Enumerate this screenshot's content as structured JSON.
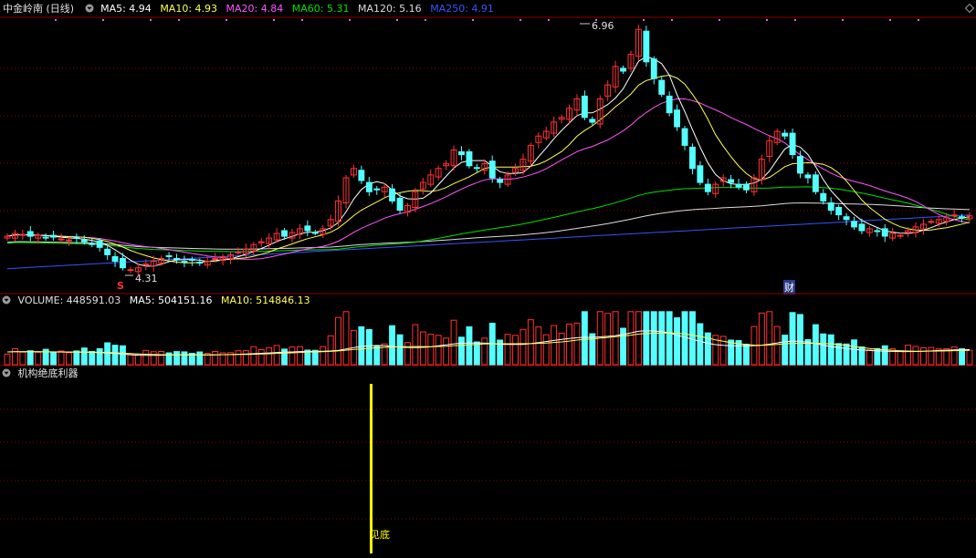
{
  "price_panel": {
    "title": "中金岭南 (日线)",
    "ma": [
      {
        "label": "MA5: 4.94",
        "color": "#ffffff"
      },
      {
        "label": "MA10: 4.93",
        "color": "#ffff55"
      },
      {
        "label": "MA20: 4.84",
        "color": "#ff55ff"
      },
      {
        "label": "MA60: 5.31",
        "color": "#00e000"
      },
      {
        "label": "MA120: 5.16",
        "color": "#dcdcdc"
      },
      {
        "label": "MA250: 4.91",
        "color": "#3355ff"
      }
    ],
    "high_label": "6.96",
    "low_label": "4.31",
    "s_marker": "S",
    "cai_marker": "财"
  },
  "volume_panel": {
    "title": "VOLUME: 448591.03",
    "ma5": "MA5: 504151.16",
    "ma10": "MA10: 514846.13"
  },
  "indicator_panel": {
    "title": "机构绝底利器",
    "signal_label": "见底"
  },
  "colors": {
    "up": "#ff3232",
    "down": "#54ffff",
    "ma5": "#ffffff",
    "ma10": "#ffff55",
    "ma20": "#ff55ff",
    "ma60": "#00e000",
    "ma120": "#dcdcdc",
    "ma250": "#3355ff",
    "signal": "#ffff00",
    "grid": "#8b0000"
  },
  "chart_data": {
    "type": "candlestick",
    "closes": [
      4.72,
      4.75,
      4.74,
      4.72,
      4.73,
      4.7,
      4.71,
      4.69,
      4.68,
      4.7,
      4.66,
      4.64,
      4.6,
      4.52,
      4.45,
      4.38,
      4.36,
      4.38,
      4.42,
      4.45,
      4.48,
      4.5,
      4.47,
      4.44,
      4.46,
      4.43,
      4.45,
      4.48,
      4.5,
      4.52,
      4.55,
      4.58,
      4.63,
      4.66,
      4.7,
      4.75,
      4.72,
      4.76,
      4.8,
      4.78,
      4.76,
      4.8,
      4.9,
      5.1,
      5.35,
      5.45,
      5.32,
      5.2,
      5.22,
      5.25,
      5.1,
      5.0,
      5.05,
      5.2,
      5.3,
      5.38,
      5.45,
      5.5,
      5.65,
      5.6,
      5.48,
      5.45,
      5.5,
      5.35,
      5.3,
      5.38,
      5.45,
      5.55,
      5.7,
      5.8,
      5.85,
      5.95,
      6.0,
      6.1,
      6.2,
      6.0,
      5.95,
      6.2,
      6.35,
      6.55,
      6.5,
      6.68,
      6.95,
      6.6,
      6.42,
      6.25,
      6.05,
      5.9,
      5.7,
      5.45,
      5.3,
      5.2,
      5.28,
      5.35,
      5.3,
      5.25,
      5.22,
      5.35,
      5.55,
      5.75,
      5.85,
      5.8,
      5.6,
      5.4,
      5.35,
      5.2,
      5.1,
      5.0,
      4.95,
      4.9,
      4.82,
      4.78,
      4.8,
      4.77,
      4.72,
      4.75,
      4.73,
      4.78,
      4.82,
      4.85,
      4.88,
      4.9,
      4.92,
      4.95,
      4.93,
      4.94
    ],
    "volume_ma5": 504151.16,
    "volume_ma10": 514846.13,
    "volume_last": 448591.03,
    "high": 6.96,
    "low": 4.31
  }
}
